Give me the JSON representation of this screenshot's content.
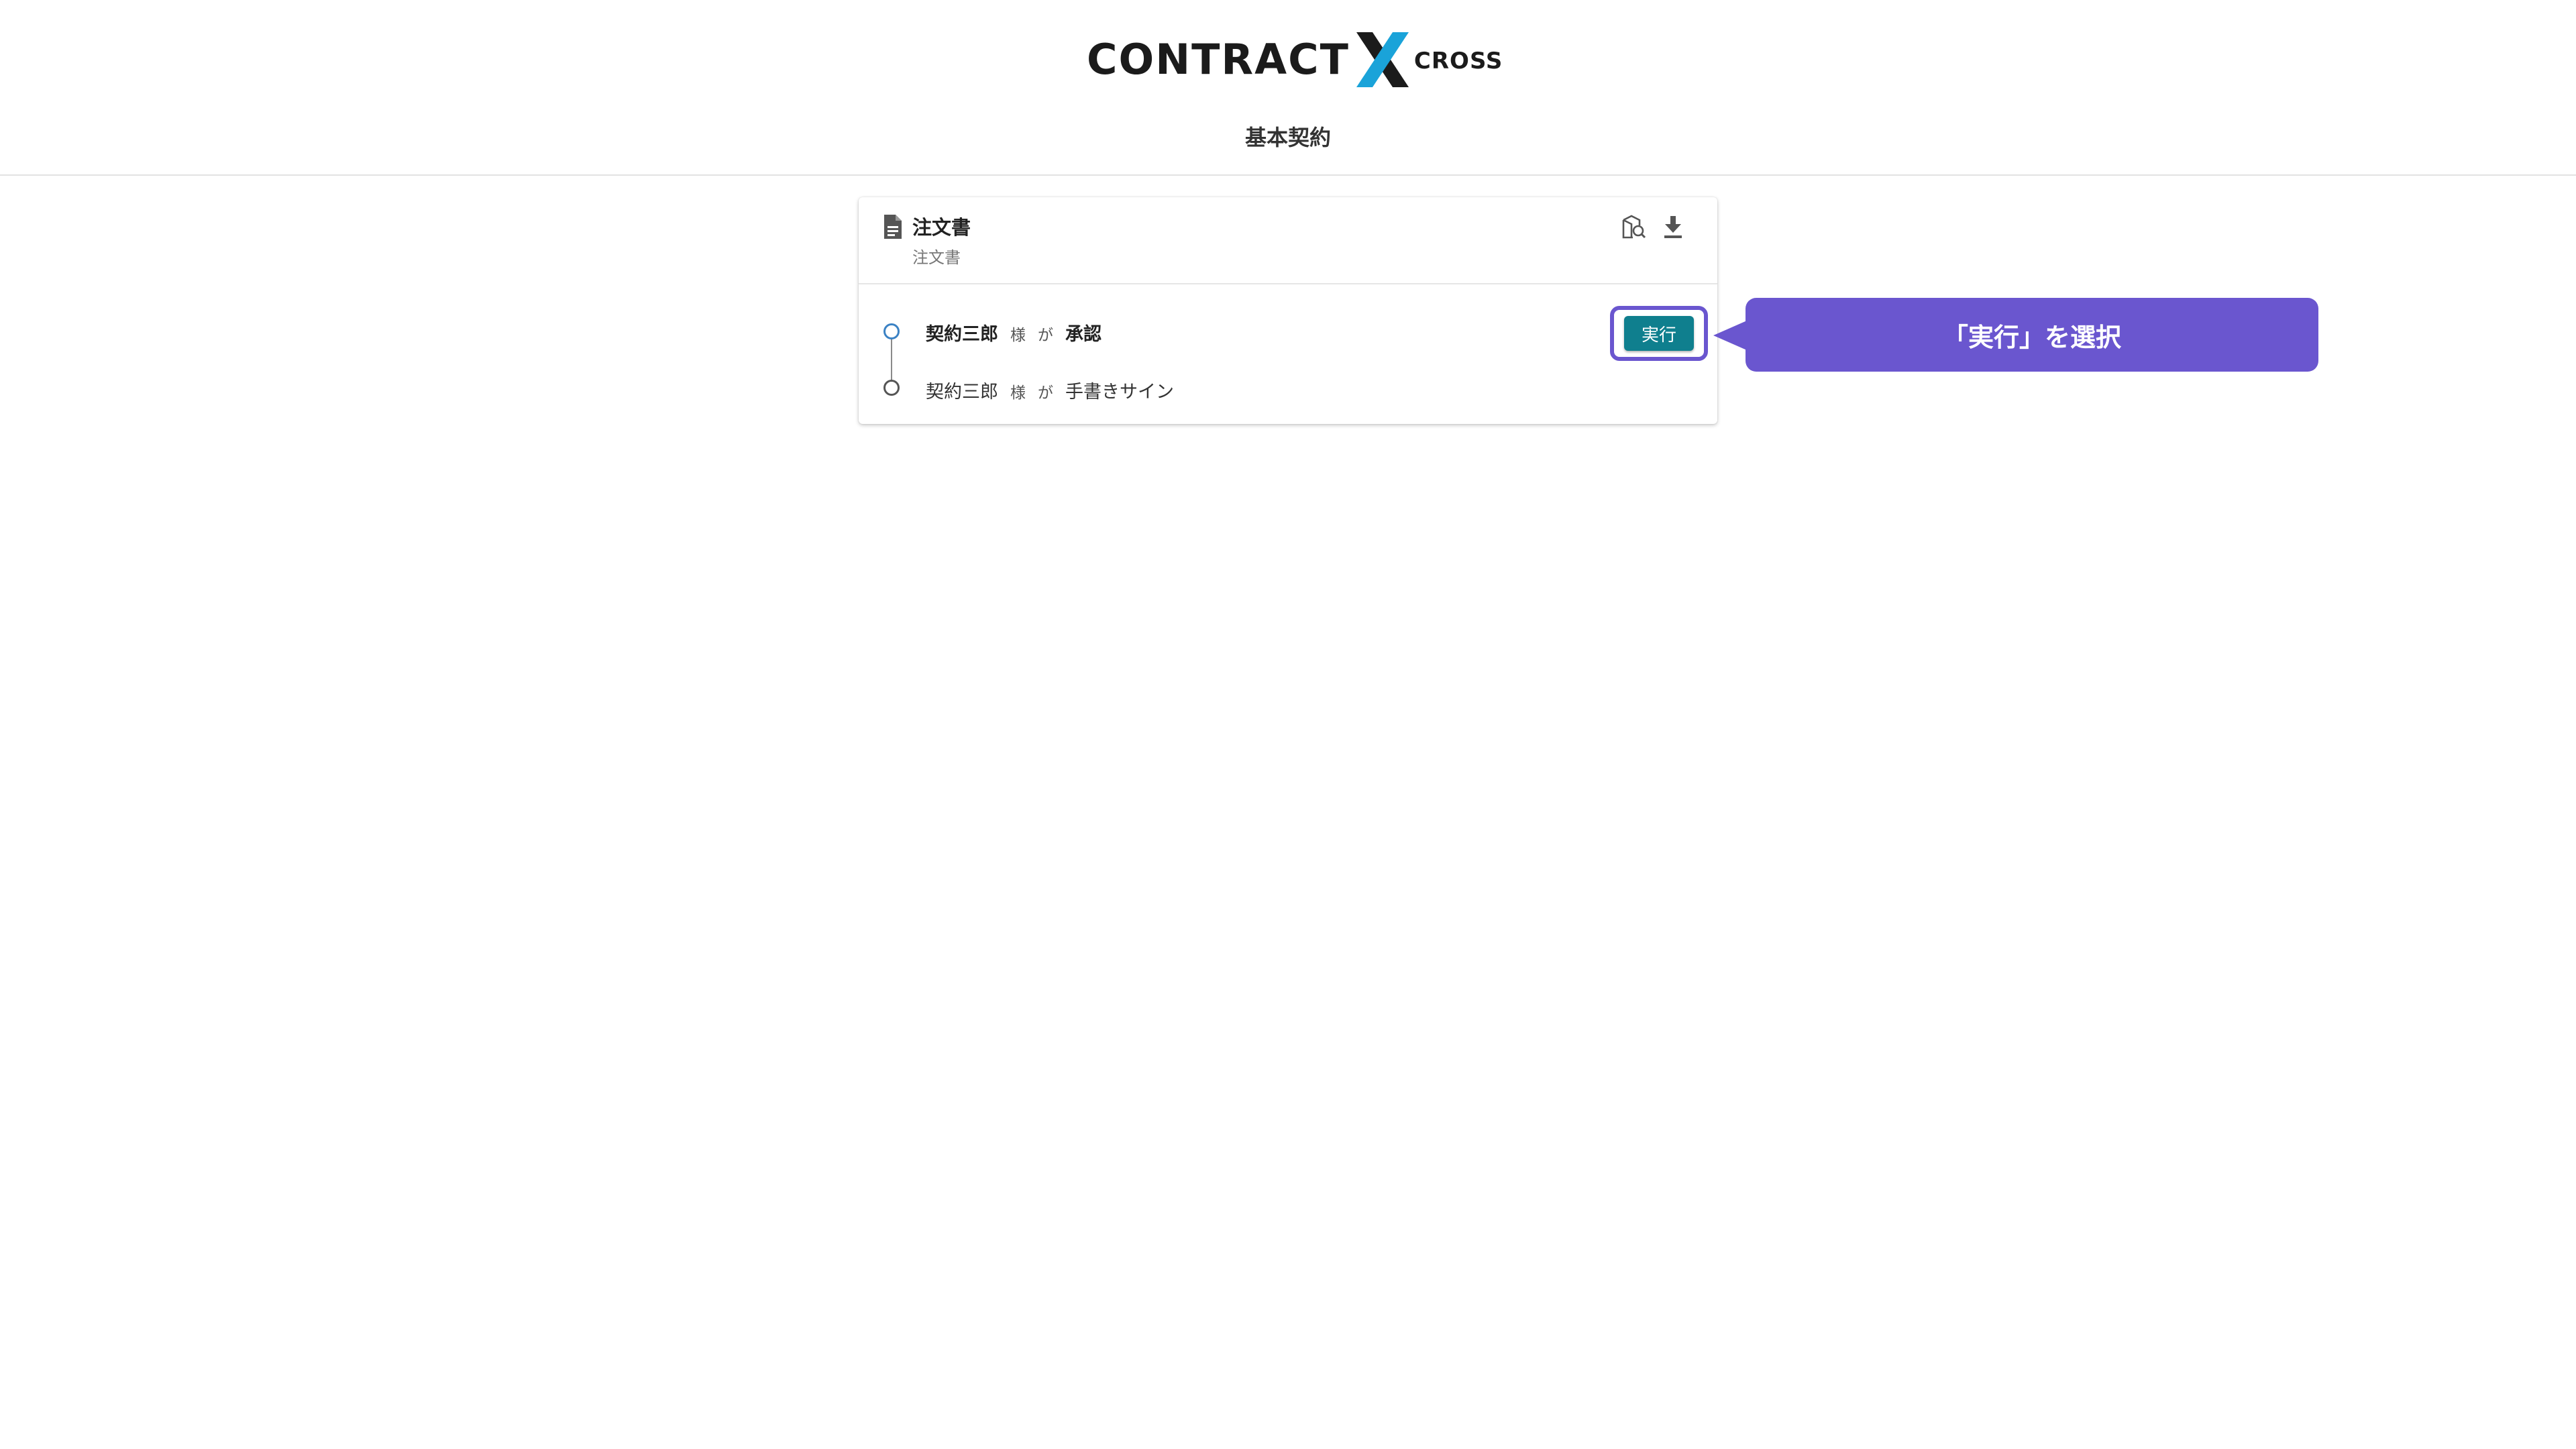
{
  "brand": {
    "logo_main": "CONTRACT",
    "logo_suffix": "CROSS",
    "accent_color": "#1aa3d9"
  },
  "page": {
    "title": "基本契約"
  },
  "document": {
    "title": "注文書",
    "subtitle": "注文書",
    "icons": [
      "document-icon",
      "location-search-icon",
      "download-icon"
    ]
  },
  "workflow": {
    "steps": [
      {
        "name": "契約三郎",
        "honorific": "様",
        "particle": "が",
        "action": "承認",
        "status": "active"
      },
      {
        "name": "契約三郎",
        "honorific": "様",
        "particle": "が",
        "action": "手書きサイン",
        "status": "pending"
      }
    ],
    "execute_label": "実行"
  },
  "annotation": {
    "callout_text": "「実行」を選択",
    "color": "#6a56cf"
  },
  "colors": {
    "execute_button": "#0f7f8e",
    "active_node": "#3b82c4"
  }
}
